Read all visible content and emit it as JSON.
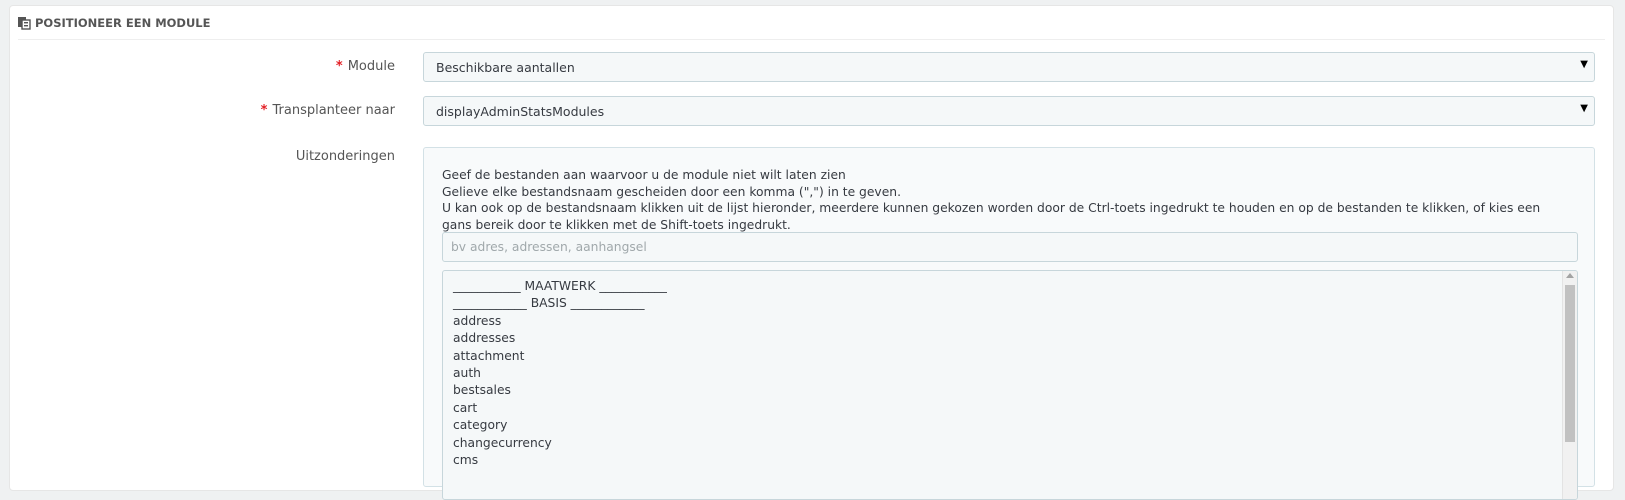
{
  "panel": {
    "title": "POSITIONEER EEN MODULE",
    "icon": "module-icon"
  },
  "form": {
    "module": {
      "label": "Module",
      "required_mark": "*",
      "value": "Beschikbare aantallen",
      "caret": "▼"
    },
    "transplant": {
      "label": "Transplanteer naar",
      "required_mark": "*",
      "value": "displayAdminStatsModules",
      "caret": "▼"
    },
    "exceptions": {
      "label": "Uitzonderingen",
      "help": [
        "Geef de bestanden aan waarvoor u de module niet wilt laten zien",
        "Gelieve elke bestandsnaam gescheiden door een komma (\",\") in te geven.",
        "U kan ook op de bestandsnaam klikken uit de lijst hieronder, meerdere kunnen gekozen worden door de Ctrl-toets ingedrukt te houden en op de bestanden te klikken, of kies een gans bereik door te klikken met de Shift-toets ingedrukt."
      ],
      "input_placeholder": "bv adres, adressen, aanhangsel",
      "list": [
        "___________ MAATWERK ___________",
        "____________ BASIS ____________",
        "address",
        "addresses",
        "attachment",
        "auth",
        "bestsales",
        "cart",
        "category",
        "changecurrency",
        "cms"
      ]
    }
  }
}
